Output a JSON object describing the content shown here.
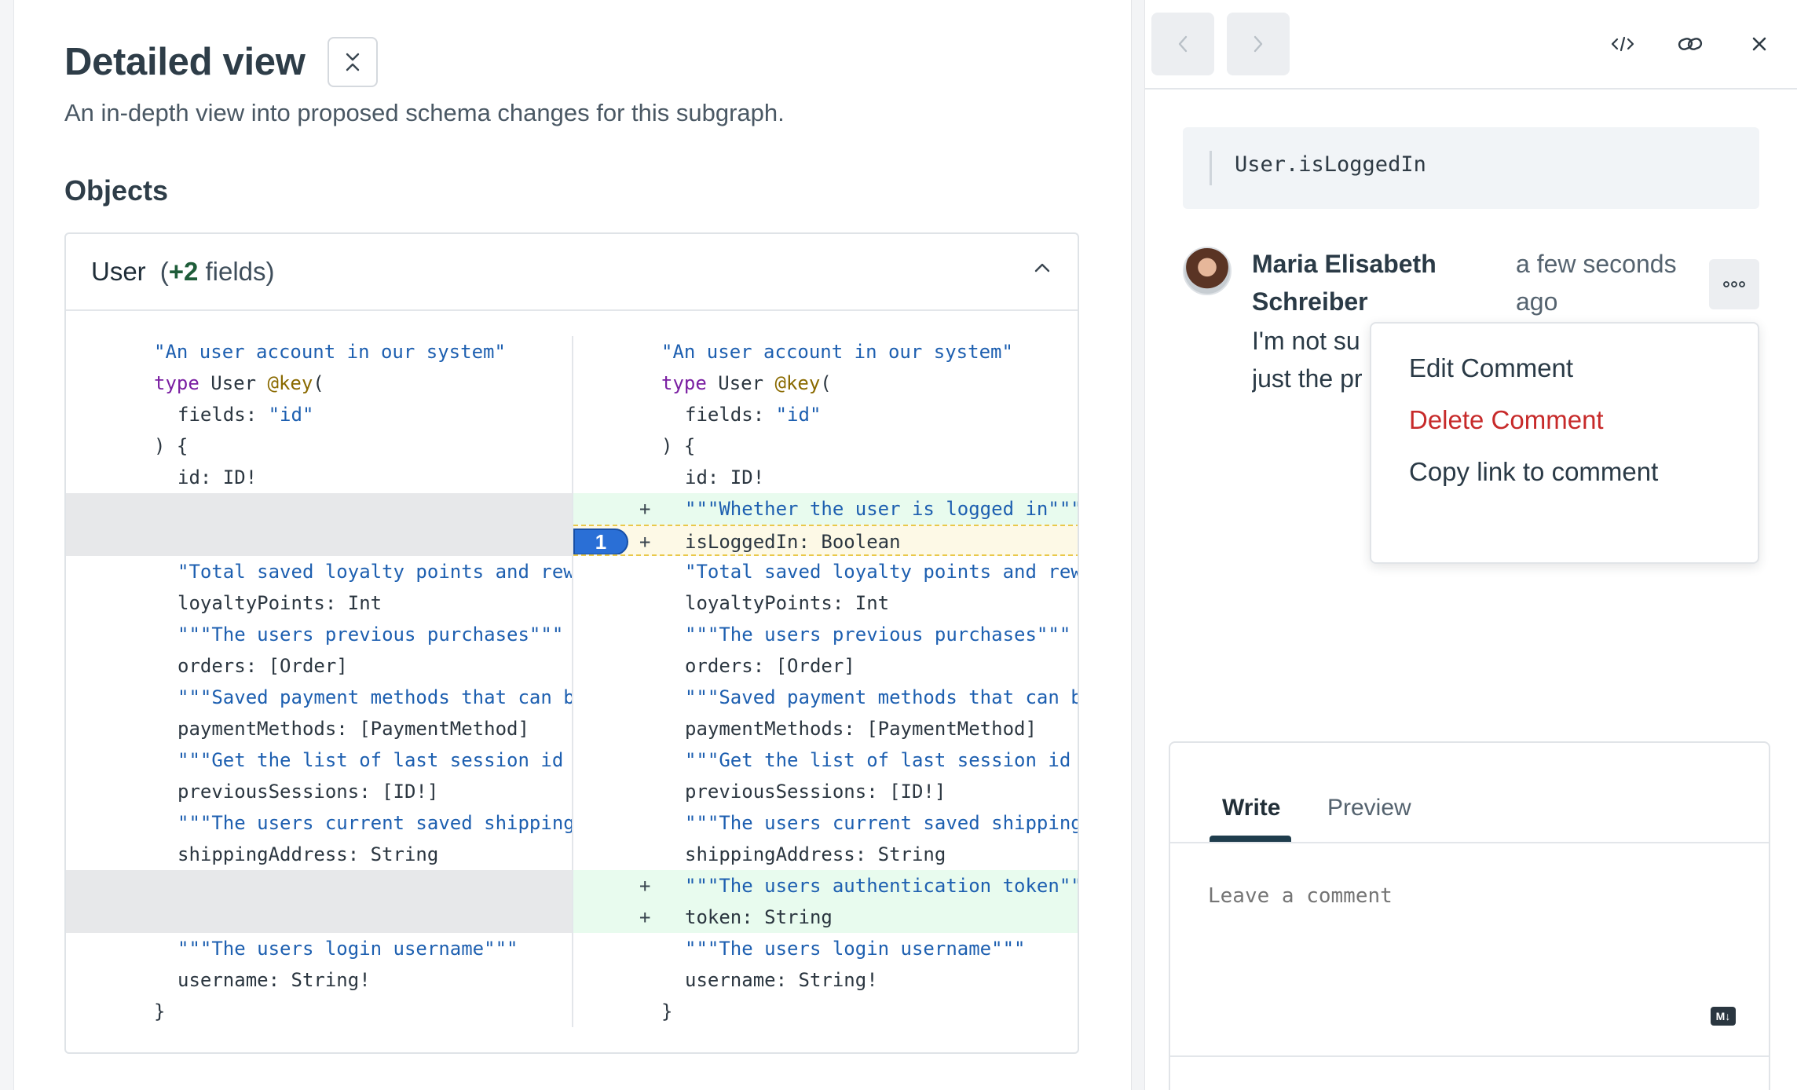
{
  "page": {
    "title": "Detailed view",
    "subtitle": "An in-depth view into proposed schema changes for this subgraph.",
    "section_heading": "Objects"
  },
  "type_card": {
    "name": "User",
    "count_prefix": "(",
    "count_num": "+2",
    "count_suffix": " fields)"
  },
  "diff": {
    "marker_number": "1",
    "left_lines": [
      {
        "kind": "ctx",
        "indent": 0,
        "tokens": [
          {
            "t": "str",
            "v": "\"An user account in our system\""
          }
        ]
      },
      {
        "kind": "ctx",
        "indent": 0,
        "tokens": [
          {
            "t": "kw",
            "v": "type"
          },
          {
            "t": "plain",
            "v": " User "
          },
          {
            "t": "dir",
            "v": "@key"
          },
          {
            "t": "plain",
            "v": "("
          }
        ]
      },
      {
        "kind": "ctx",
        "indent": 1,
        "tokens": [
          {
            "t": "plain",
            "v": "fields: "
          },
          {
            "t": "str",
            "v": "\"id\""
          }
        ]
      },
      {
        "kind": "ctx",
        "indent": 0,
        "tokens": [
          {
            "t": "plain",
            "v": ") {"
          }
        ]
      },
      {
        "kind": "ctx",
        "indent": 1,
        "tokens": [
          {
            "t": "plain",
            "v": "id: ID!"
          }
        ]
      },
      {
        "kind": "empty",
        "indent": 0,
        "tokens": []
      },
      {
        "kind": "empty",
        "indent": 0,
        "tokens": []
      },
      {
        "kind": "ctx",
        "indent": 1,
        "tokens": [
          {
            "t": "str",
            "v": "\"Total saved loyalty points and rew"
          }
        ]
      },
      {
        "kind": "ctx",
        "indent": 1,
        "tokens": [
          {
            "t": "plain",
            "v": "loyaltyPoints: Int"
          }
        ]
      },
      {
        "kind": "ctx",
        "indent": 1,
        "tokens": [
          {
            "t": "str",
            "v": "\"\"\"The users previous purchases\"\"\""
          }
        ]
      },
      {
        "kind": "ctx",
        "indent": 1,
        "tokens": [
          {
            "t": "plain",
            "v": "orders: [Order]"
          }
        ]
      },
      {
        "kind": "ctx",
        "indent": 1,
        "tokens": [
          {
            "t": "str",
            "v": "\"\"\"Saved payment methods that can b"
          }
        ]
      },
      {
        "kind": "ctx",
        "indent": 1,
        "tokens": [
          {
            "t": "plain",
            "v": "paymentMethods: [PaymentMethod]"
          }
        ]
      },
      {
        "kind": "ctx",
        "indent": 1,
        "tokens": [
          {
            "t": "str",
            "v": "\"\"\"Get the list of last session id"
          }
        ]
      },
      {
        "kind": "ctx",
        "indent": 1,
        "tokens": [
          {
            "t": "plain",
            "v": "previousSessions: [ID!]"
          }
        ]
      },
      {
        "kind": "ctx",
        "indent": 1,
        "tokens": [
          {
            "t": "str",
            "v": "\"\"\"The users current saved shipping"
          }
        ]
      },
      {
        "kind": "ctx",
        "indent": 1,
        "tokens": [
          {
            "t": "plain",
            "v": "shippingAddress: String"
          }
        ]
      },
      {
        "kind": "empty",
        "indent": 0,
        "tokens": []
      },
      {
        "kind": "empty",
        "indent": 0,
        "tokens": []
      },
      {
        "kind": "ctx",
        "indent": 1,
        "tokens": [
          {
            "t": "str",
            "v": "\"\"\"The users login username\"\"\""
          }
        ]
      },
      {
        "kind": "ctx",
        "indent": 1,
        "tokens": [
          {
            "t": "plain",
            "v": "username: String!"
          }
        ]
      },
      {
        "kind": "ctx",
        "indent": 0,
        "tokens": [
          {
            "t": "plain",
            "v": "}"
          }
        ]
      }
    ],
    "right_lines": [
      {
        "kind": "ctx",
        "indent": 0,
        "tokens": [
          {
            "t": "str",
            "v": "\"An user account in our system\""
          }
        ]
      },
      {
        "kind": "ctx",
        "indent": 0,
        "tokens": [
          {
            "t": "kw",
            "v": "type"
          },
          {
            "t": "plain",
            "v": " User "
          },
          {
            "t": "dir",
            "v": "@key"
          },
          {
            "t": "plain",
            "v": "("
          }
        ]
      },
      {
        "kind": "ctx",
        "indent": 1,
        "tokens": [
          {
            "t": "plain",
            "v": "fields: "
          },
          {
            "t": "str",
            "v": "\"id\""
          }
        ]
      },
      {
        "kind": "ctx",
        "indent": 0,
        "tokens": [
          {
            "t": "plain",
            "v": ") {"
          }
        ]
      },
      {
        "kind": "ctx",
        "indent": 1,
        "tokens": [
          {
            "t": "plain",
            "v": "id: ID!"
          }
        ]
      },
      {
        "kind": "add",
        "indent": 1,
        "tokens": [
          {
            "t": "str",
            "v": "\"\"\"Whether the user is logged in\"\"\""
          }
        ]
      },
      {
        "kind": "add-hl",
        "indent": 1,
        "tokens": [
          {
            "t": "plain",
            "v": "isLoggedIn: Boolean"
          }
        ]
      },
      {
        "kind": "ctx",
        "indent": 1,
        "tokens": [
          {
            "t": "str",
            "v": "\"Total saved loyalty points and rew"
          }
        ]
      },
      {
        "kind": "ctx",
        "indent": 1,
        "tokens": [
          {
            "t": "plain",
            "v": "loyaltyPoints: Int"
          }
        ]
      },
      {
        "kind": "ctx",
        "indent": 1,
        "tokens": [
          {
            "t": "str",
            "v": "\"\"\"The users previous purchases\"\"\""
          }
        ]
      },
      {
        "kind": "ctx",
        "indent": 1,
        "tokens": [
          {
            "t": "plain",
            "v": "orders: [Order]"
          }
        ]
      },
      {
        "kind": "ctx",
        "indent": 1,
        "tokens": [
          {
            "t": "str",
            "v": "\"\"\"Saved payment methods that can b"
          }
        ]
      },
      {
        "kind": "ctx",
        "indent": 1,
        "tokens": [
          {
            "t": "plain",
            "v": "paymentMethods: [PaymentMethod]"
          }
        ]
      },
      {
        "kind": "ctx",
        "indent": 1,
        "tokens": [
          {
            "t": "str",
            "v": "\"\"\"Get the list of last session id"
          }
        ]
      },
      {
        "kind": "ctx",
        "indent": 1,
        "tokens": [
          {
            "t": "plain",
            "v": "previousSessions: [ID!]"
          }
        ]
      },
      {
        "kind": "ctx",
        "indent": 1,
        "tokens": [
          {
            "t": "str",
            "v": "\"\"\"The users current saved shipping"
          }
        ]
      },
      {
        "kind": "ctx",
        "indent": 1,
        "tokens": [
          {
            "t": "plain",
            "v": "shippingAddress: String"
          }
        ]
      },
      {
        "kind": "add",
        "indent": 1,
        "tokens": [
          {
            "t": "str",
            "v": "\"\"\"The users authentication token\"\""
          }
        ]
      },
      {
        "kind": "add",
        "indent": 1,
        "tokens": [
          {
            "t": "plain",
            "v": "token: String"
          }
        ]
      },
      {
        "kind": "ctx",
        "indent": 1,
        "tokens": [
          {
            "t": "str",
            "v": "\"\"\"The users login username\"\"\""
          }
        ]
      },
      {
        "kind": "ctx",
        "indent": 1,
        "tokens": [
          {
            "t": "plain",
            "v": "username: String!"
          }
        ]
      },
      {
        "kind": "ctx",
        "indent": 0,
        "tokens": [
          {
            "t": "plain",
            "v": "}"
          }
        ]
      }
    ]
  },
  "panel": {
    "icons": [
      "chevron-left-icon",
      "chevron-right-icon",
      "code-icon",
      "link-icon",
      "close-icon"
    ],
    "coordinate": "User.isLoggedIn",
    "comment": {
      "author": "Maria Elisabeth Schreiber",
      "time": "a few seconds ago",
      "text_visible": "I'm not su",
      "text_visible_2": "just the pr"
    },
    "menu": {
      "edit": "Edit Comment",
      "delete": "Delete Comment",
      "copy": "Copy link to comment"
    },
    "editor": {
      "tab_write": "Write",
      "tab_preview": "Preview",
      "placeholder": "Leave a comment",
      "md_badge": "M↓"
    }
  },
  "colors": {
    "accent_blue": "#2a6fd6",
    "added_bg": "#e8fbee",
    "danger": "#c72a2a",
    "string": "#1d5fb0",
    "keyword": "#7a1fa2"
  }
}
